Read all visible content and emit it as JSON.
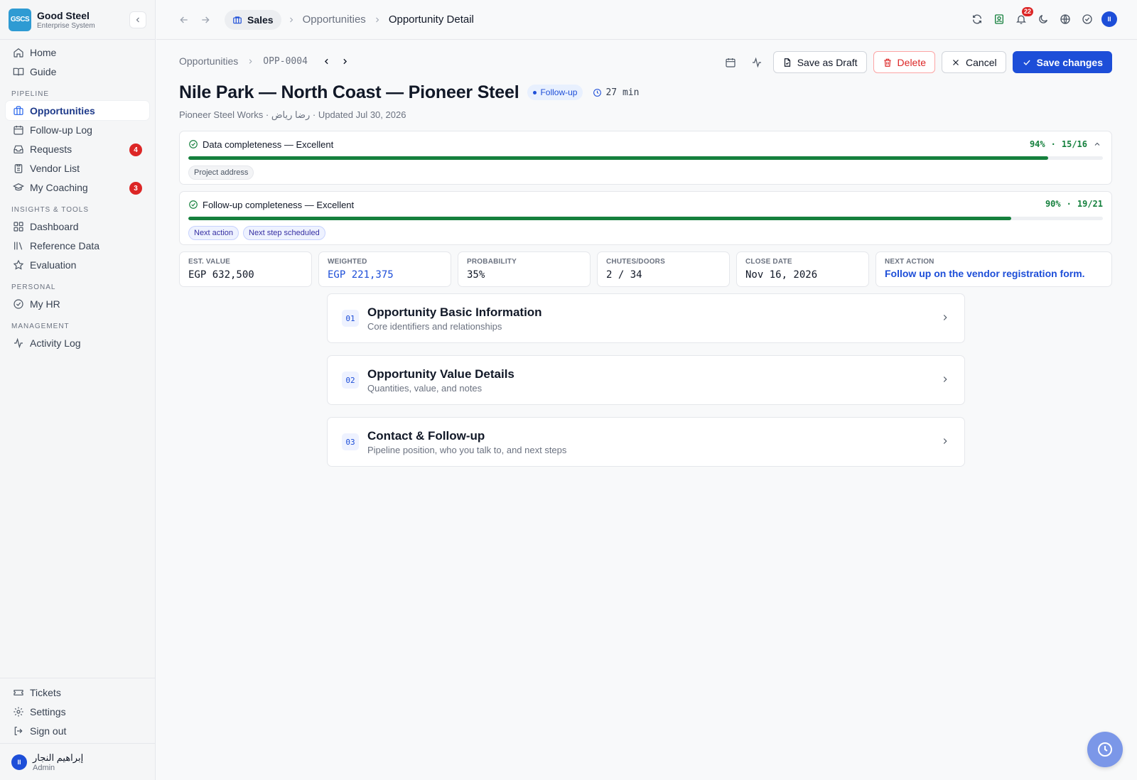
{
  "brand": {
    "logo_text": "GSCS",
    "name": "Good Steel",
    "subtitle": "Enterprise System"
  },
  "sidebar": {
    "top": [
      {
        "label": "Home",
        "icon": "home-icon"
      },
      {
        "label": "Guide",
        "icon": "book-icon"
      }
    ],
    "sections": [
      {
        "title": "PIPELINE",
        "items": [
          {
            "label": "Opportunities",
            "icon": "briefcase-icon",
            "active": true
          },
          {
            "label": "Follow-up Log",
            "icon": "calendar-icon"
          },
          {
            "label": "Requests",
            "icon": "inbox-icon",
            "badge": "4"
          },
          {
            "label": "Vendor List",
            "icon": "clipboard-icon"
          },
          {
            "label": "My Coaching",
            "icon": "graduation-cap-icon",
            "badge": "3"
          }
        ]
      },
      {
        "title": "INSIGHTS & TOOLS",
        "items": [
          {
            "label": "Dashboard",
            "icon": "grid-icon"
          },
          {
            "label": "Reference Data",
            "icon": "library-icon"
          },
          {
            "label": "Evaluation",
            "icon": "star-icon"
          }
        ]
      },
      {
        "title": "PERSONAL",
        "items": [
          {
            "label": "My HR",
            "icon": "check-circle-icon"
          }
        ]
      },
      {
        "title": "MANAGEMENT",
        "items": [
          {
            "label": "Activity Log",
            "icon": "activity-icon"
          }
        ]
      }
    ],
    "bottom": [
      {
        "label": "Tickets",
        "icon": "ticket-icon"
      },
      {
        "label": "Settings",
        "icon": "gear-icon"
      },
      {
        "label": "Sign out",
        "icon": "sign-out-icon"
      }
    ],
    "user": {
      "initials": "II",
      "name": "إبراهيم النجار",
      "role": "Admin"
    }
  },
  "topbar": {
    "module": "Sales",
    "crumbs": [
      "Opportunities",
      "Opportunity Detail"
    ],
    "notification_count": "22"
  },
  "subheader": {
    "crumb": "Opportunities",
    "record_id": "OPP-0004",
    "buttons": {
      "draft": "Save as Draft",
      "delete": "Delete",
      "cancel": "Cancel",
      "save": "Save changes"
    }
  },
  "record": {
    "title": "Nile Park — North Coast — Pioneer Steel",
    "status": "Follow-up",
    "timer": "27 min",
    "meta": "Pioneer Steel Works · رضا رياض · Updated Jul 30, 2026"
  },
  "completeness": [
    {
      "label": "Data completeness — Excellent",
      "percent_text": "94%",
      "count": "15/16",
      "fraction": 0.94,
      "tags": [
        "Project address"
      ],
      "tag_style": "gray",
      "collapsible": true
    },
    {
      "label": "Follow-up completeness — Excellent",
      "percent_text": "90%",
      "count": "19/21",
      "fraction": 0.9,
      "tags": [
        "Next action",
        "Next step scheduled"
      ],
      "tag_style": "blue",
      "collapsible": false
    }
  ],
  "kpis": [
    {
      "label": "EST. VALUE",
      "value": "EGP 632,500",
      "style": "mono"
    },
    {
      "label": "WEIGHTED",
      "value": "EGP 221,375",
      "style": "mono-blue"
    },
    {
      "label": "PROBABILITY",
      "value": "35%",
      "style": "mono"
    },
    {
      "label": "CHUTES/DOORS",
      "value": "2 / 34",
      "style": "mono"
    },
    {
      "label": "CLOSE DATE",
      "value": "Nov 16, 2026",
      "style": "mono"
    },
    {
      "label": "NEXT ACTION",
      "value": "Follow up on the vendor registration form.",
      "style": "link"
    }
  ],
  "sections": [
    {
      "num": "01",
      "title": "Opportunity Basic Information",
      "subtitle": "Core identifiers and relationships"
    },
    {
      "num": "02",
      "title": "Opportunity Value Details",
      "subtitle": "Quantities, value, and notes"
    },
    {
      "num": "03",
      "title": "Contact & Follow-up",
      "subtitle": "Pipeline position, who you talk to, and next steps"
    }
  ],
  "colors": {
    "accent": "#1d4ed8",
    "success": "#15803d",
    "danger": "#dc2626",
    "logo": "#2e9bd3"
  }
}
